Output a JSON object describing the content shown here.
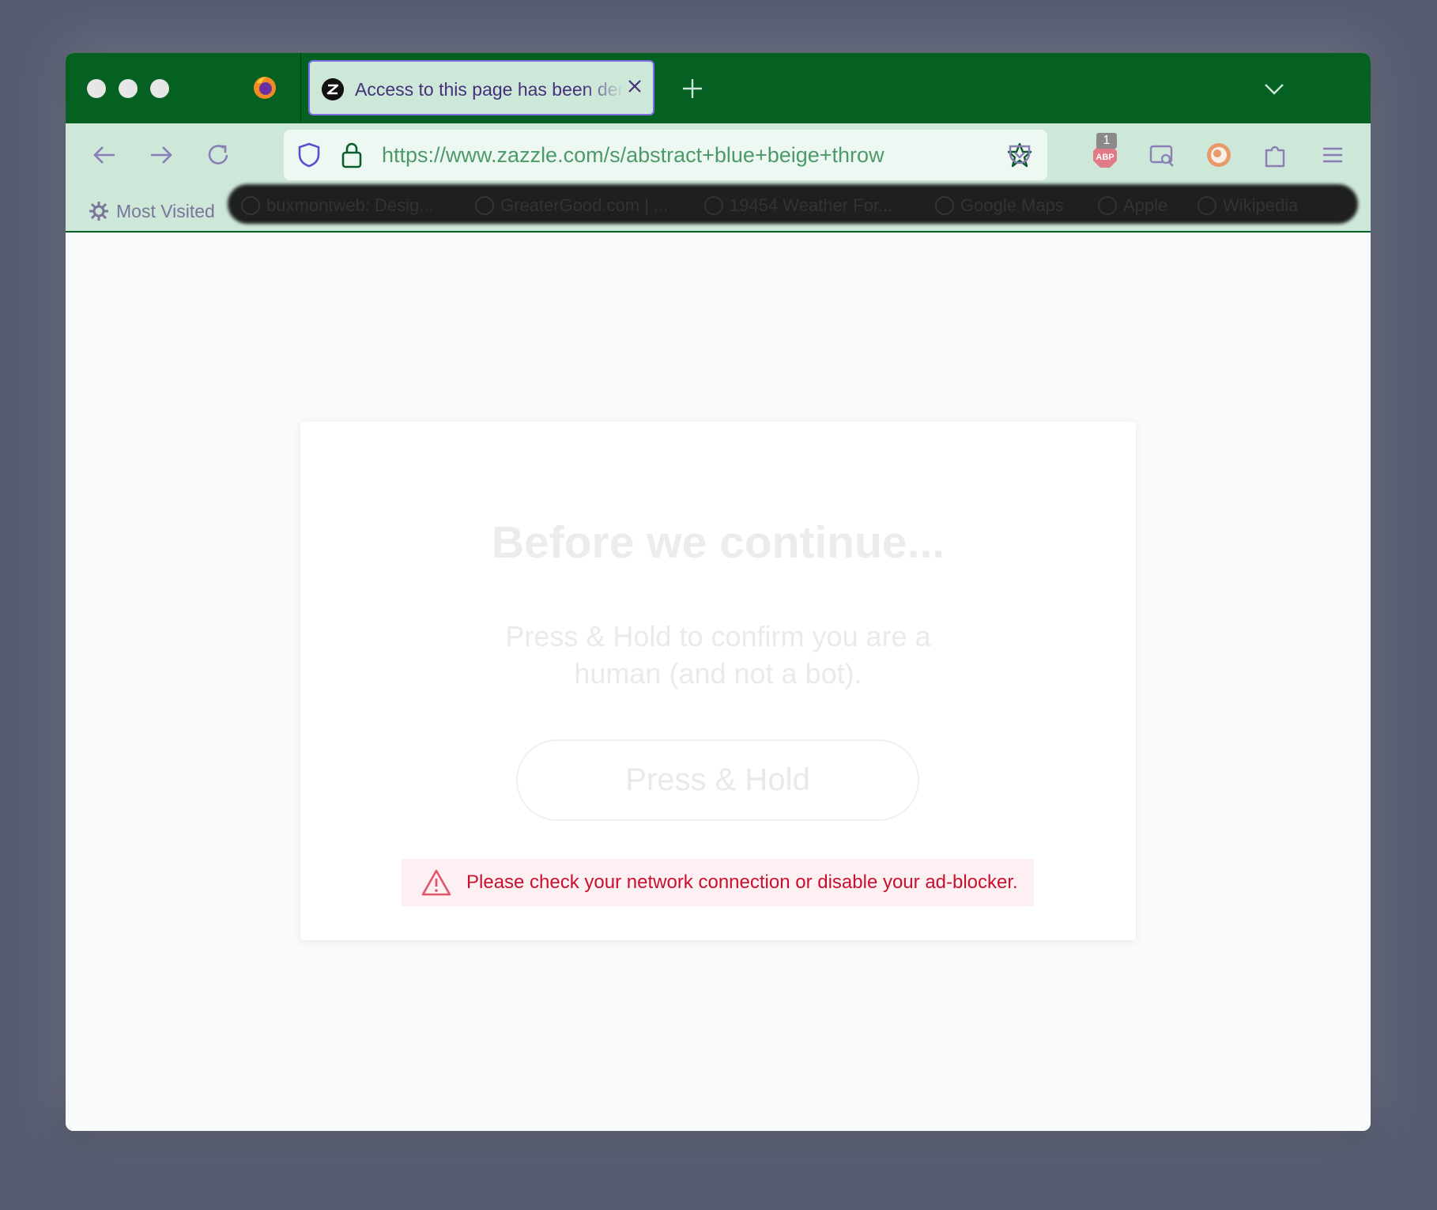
{
  "browser": {
    "tab": {
      "title": "Access to this page has been denied"
    },
    "url": "https://www.zazzle.com/s/abstract+blue+beige+throw",
    "extensions": {
      "adblock_label": "ABP",
      "adblock_badge": "1"
    },
    "bookmarks": {
      "most_visited": "Most Visited",
      "items": [
        "buxmontweb: Desig...",
        "GreaterGood.com | ...",
        "19454 Weather For...",
        "Google Maps",
        "Apple",
        "Wikipedia"
      ]
    }
  },
  "page": {
    "title": "Before we continue...",
    "subtitle": "Press & Hold to confirm you are a human (and not a bot).",
    "button_label": "Press & Hold",
    "error_message": "Please check your network connection or disable your ad-blocker."
  },
  "colors": {
    "tabbar": "#046122",
    "toolbar": "#cde7d9",
    "tab_border": "#7d6ce3",
    "error_text": "#c8102e",
    "error_bg": "#fdf0f2"
  },
  "icons": [
    "firefox-icon",
    "zazzle-favicon-icon",
    "close-icon",
    "plus-icon",
    "chevron-down-icon",
    "back-arrow-icon",
    "forward-arrow-icon",
    "reload-icon",
    "shield-icon",
    "lock-icon",
    "star-icon",
    "pocket-icon",
    "adblock-icon",
    "screenshot-icon",
    "duckduckgo-icon",
    "puzzle-icon",
    "hamburger-menu-icon",
    "gear-icon",
    "warning-triangle-icon"
  ]
}
